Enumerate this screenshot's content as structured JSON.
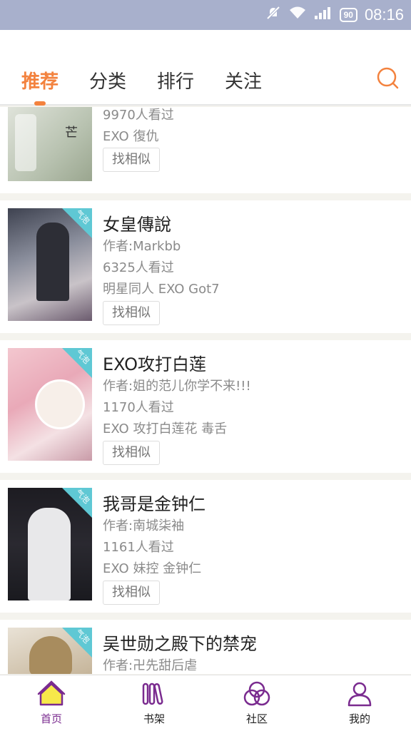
{
  "status": {
    "time": "08:16",
    "battery": "90"
  },
  "tabs": [
    {
      "label": "推荐",
      "active": true
    },
    {
      "label": "分类"
    },
    {
      "label": "排行"
    },
    {
      "label": "关注"
    }
  ],
  "books": [
    {
      "title": "",
      "author": "",
      "views": "9970人看过",
      "tags": "EXO  復仇",
      "similar": "找相似",
      "ribbon": "",
      "cover_text": "芒"
    },
    {
      "title": "女皇傳說",
      "author": "作者:Markbb",
      "views": "6325人看过",
      "tags": "明星同人  EXO   Got7",
      "similar": "找相似",
      "ribbon": "气泡"
    },
    {
      "title": "EXO攻打白莲",
      "author": "作者:姐的范儿你学不来!!!",
      "views": "1170人看过",
      "tags": "EXO  攻打白莲花  毒舌",
      "similar": "找相似",
      "ribbon": "气泡"
    },
    {
      "title": "我哥是金钟仁",
      "author": "作者:南城柒袖",
      "views": "1161人看过",
      "tags": "EXO  妹控  金钟仁",
      "similar": "找相似",
      "ribbon": "气泡"
    },
    {
      "title": "吴世勋之殿下的禁宠",
      "author": "作者:卍先甜后虐",
      "views": "",
      "tags": "",
      "similar": "",
      "ribbon": "气泡"
    }
  ],
  "nav": [
    {
      "label": "首页",
      "icon": "home-icon",
      "active": true
    },
    {
      "label": "书架",
      "icon": "bookshelf-icon"
    },
    {
      "label": "社区",
      "icon": "community-icon"
    },
    {
      "label": "我的",
      "icon": "profile-icon"
    }
  ],
  "colors": {
    "accent": "#f3823e",
    "nav_purple": "#7a2b8f",
    "ribbon": "#5fc8d4",
    "statusbar": "#a8b0cc"
  }
}
